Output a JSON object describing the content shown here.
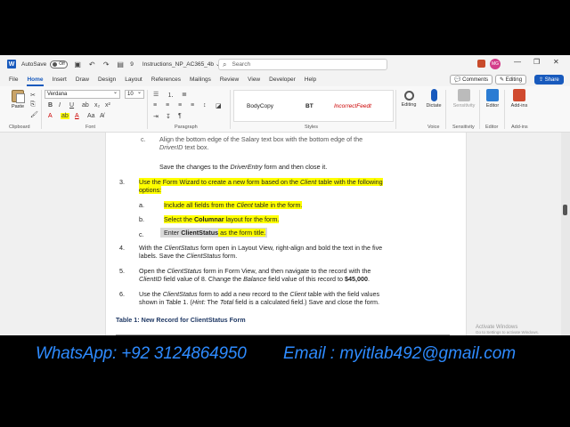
{
  "titlebar": {
    "autosave_label": "AutoSave",
    "toggle_label": "Off",
    "file_num": "9",
    "doc_title": "Instructions_NP_AC365_4b",
    "search_placeholder": "Search",
    "avatar_initials": "MG",
    "minimize": "—",
    "restore": "❐",
    "close": "✕"
  },
  "menu": {
    "tabs": [
      "File",
      "Home",
      "Insert",
      "Draw",
      "Design",
      "Layout",
      "References",
      "Mailings",
      "Review",
      "View",
      "Developer",
      "Help"
    ],
    "active": "Home",
    "comments": "Comments",
    "editing": "Editing",
    "share": "Share"
  },
  "ribbon": {
    "paste": "Paste",
    "font_name": "Verdana",
    "font_size": "10",
    "styles": [
      "BodyCopy",
      "BT",
      "IncorrectFeedt"
    ],
    "editing_btn": "Editing",
    "dictate_btn": "Dictate",
    "sensitivity_btn": "Sensitivity",
    "editor_btn": "Editor",
    "addins_btn": "Add-ins",
    "group_labels": {
      "clipboard": "Clipboard",
      "font": "Font",
      "paragraph": "Paragraph",
      "styles": "Styles",
      "voice": "Voice",
      "sensitivity": "Sensitivity",
      "editor": "Editor",
      "addins": "Add-ins"
    }
  },
  "document": {
    "partial_top_line1_letter": "c.",
    "partial_top_line1_a": "Align the bottom edge of the Salary text box with the bottom edge of the",
    "partial_top_line2_italic": "DriverID",
    "partial_top_line2_b": " text box.",
    "save_line_a": "Save the changes to the ",
    "save_line_italic": "DriverEntry",
    "save_line_b": " form and then close it.",
    "item3_num": "3.",
    "item3_line1_a": "Use the Form Wizard to create a new form based on the ",
    "item3_line1_italic": "Client",
    "item3_line1_b": " table with the following",
    "item3_line2": "options:",
    "sub_a_letter": "a.",
    "sub_a_a": "Include all fields from the ",
    "sub_a_italic": "Client",
    "sub_a_b": " table in the form.",
    "sub_b_letter": "b.",
    "sub_b_a": "Select the ",
    "sub_b_bold": "Columnar",
    "sub_b_b": " layout for the form.",
    "sub_c_letter": "c.",
    "sub_c_a": "Enter ",
    "sub_c_bold": "ClientStatus",
    "sub_c_b": " as the form title.",
    "item4_num": "4.",
    "item4_line1_a": "With the ",
    "item4_line1_italic": "ClientStatus",
    "item4_line1_b": " form open in Layout View, right-align and bold the text in the five",
    "item4_line2_a": "labels. Save the ",
    "item4_line2_italic": "ClientStatus",
    "item4_line2_b": " form.",
    "item5_num": "5.",
    "item5_line1_a": "Open the ",
    "item5_line1_italic": "ClientStatus",
    "item5_line1_b": " form in Form View, and then navigate to the record with the",
    "item5_line2_italic1": "ClientID",
    "item5_line2_a": " field value of 8. Change the ",
    "item5_line2_italic2": "Balance",
    "item5_line2_b": " field value of this record to ",
    "item5_line2_bold": "$45,000",
    "item5_line2_c": ".",
    "item6_num": "6.",
    "item6_line1_a": "Use the ",
    "item6_line1_italic": "ClientStatus",
    "item6_line1_b": " form to add a new record to the ",
    "item6_line1_italic2": "Client",
    "item6_line1_c": " table with the field values",
    "item6_line2_a": "shown in Table 1. (",
    "item6_line2_italic": "Hint:",
    "item6_line2_b": " The ",
    "item6_line2_italic2": "Total",
    "item6_line2_c": " field is a calculated field.) Save and close the form.",
    "table_caption": "Table 1: New Record for ClientStatus Form",
    "activate_title": "Activate Windows",
    "activate_sub": "Go to Settings to activate Windows."
  },
  "banner": {
    "whatsapp": "WhatsApp: +92 3124864950",
    "email": "Email : myitlab492@gmail.com"
  },
  "colors": {
    "word_blue": "#185abd",
    "highlight": "#ffff00",
    "banner_text": "#2e8bff"
  }
}
